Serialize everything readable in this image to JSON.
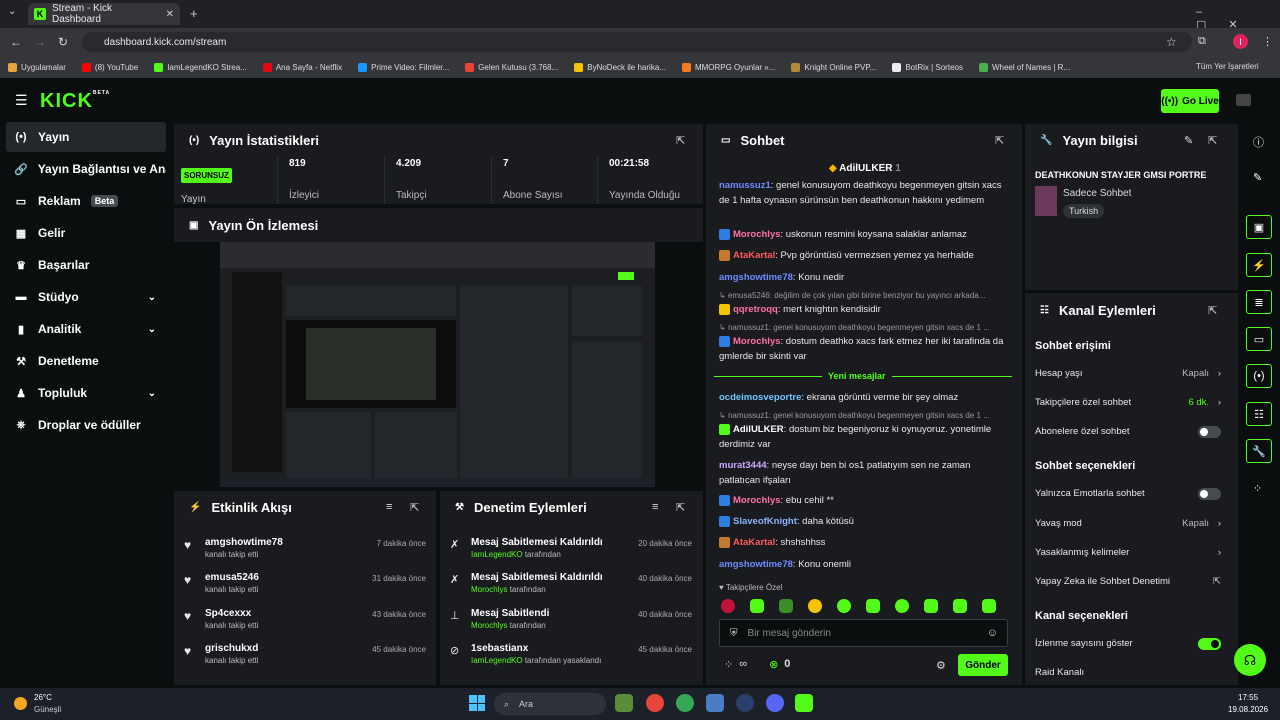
{
  "browser": {
    "tab_title": "Stream - Kick Dashboard",
    "url": "dashboard.kick.com/stream",
    "bookmarks": [
      "Uygulamalar",
      "(8) YouTube",
      "IamLegendKO Strea...",
      "Ana Sayfa - Netflix",
      "Prime Video: Filmler...",
      "Gelen Kutusu (3.768...",
      "ByNoDeck ile harika...",
      "MMORPG Oyunlar »...",
      "Knight Online PVP...",
      "BotRix | Sorteos",
      "Wheel of Names | R..."
    ],
    "all_bookmarks": "Tüm Yer İşaretleri",
    "profile_initial": "I"
  },
  "header": {
    "logo": "KICK",
    "logo_sup": "BETA",
    "go_live": "Go Live"
  },
  "sidebar": {
    "items": [
      {
        "label": "Yayın",
        "icon": "broadcast-icon"
      },
      {
        "label": "Yayın Bağlantısı ve Anahtarı",
        "icon": "link-icon"
      },
      {
        "label": "Reklam",
        "icon": "ad-icon",
        "badge": "Beta"
      },
      {
        "label": "Gelir",
        "icon": "revenue-icon"
      },
      {
        "label": "Başarılar",
        "icon": "trophy-icon"
      },
      {
        "label": "Stüdyo",
        "icon": "studio-icon"
      },
      {
        "label": "Analitik",
        "icon": "analytics-icon"
      },
      {
        "label": "Denetleme",
        "icon": "moderation-icon"
      },
      {
        "label": "Topluluk",
        "icon": "community-icon"
      },
      {
        "label": "Droplar ve ödüller",
        "icon": "gift-icon"
      }
    ]
  },
  "stats": {
    "title": "Yayın İstatistikleri",
    "status_badge": "SORUNSUZ",
    "status_label": "Yayın",
    "viewers": "819",
    "viewers_label": "İzleyici",
    "followers": "4.209",
    "followers_label": "Takipçi",
    "subs": "7",
    "subs_label": "Abone Sayısı",
    "uptime": "00:21:58",
    "uptime_label": "Yayında Olduğu"
  },
  "preview": {
    "title": "Yayın Ön İzlemesi"
  },
  "activity": {
    "title": "Etkinlik Akışı",
    "items": [
      {
        "user": "amgshowtime78",
        "action": "kanalı takip etti",
        "time": "7 dakika önce"
      },
      {
        "user": "emusa5246",
        "action": "kanalı takip etti",
        "time": "31 dakika önce"
      },
      {
        "user": "Sp4cexxx",
        "action": "kanalı takip etti",
        "time": "43 dakika önce"
      },
      {
        "user": "grischukxd",
        "action": "kanalı takip etti",
        "time": "45 dakika önce"
      }
    ]
  },
  "modlog": {
    "title": "Denetim Eylemleri",
    "items": [
      {
        "title": "Mesaj Sabitlemesi Kaldırıldı",
        "mod": "IamLegendKO",
        "suffix": "tarafından",
        "time": "20 dakika önce"
      },
      {
        "title": "Mesaj Sabitlemesi Kaldırıldı",
        "mod": "Morochlys",
        "suffix": "tarafından",
        "time": "40 dakika önce"
      },
      {
        "title": "Mesaj Sabitlendi",
        "mod": "Morochlys",
        "suffix": "tarafından",
        "time": "40 dakika önce"
      },
      {
        "title": "1sebastianx",
        "mod": "IamLegendKO",
        "suffix": "tarafından yasaklandı",
        "time": "45 dakika önce"
      }
    ]
  },
  "chat": {
    "title": "Sohbet",
    "pinned_user": "AdilULKER",
    "pinned_count": "1",
    "new_messages": "Yeni mesajlar",
    "messages": [
      {
        "user": "namussuz1",
        "color": "#6b8cff",
        "text": "genel konusuyom deathkoyu begenmeyen gitsin xacs de 1 hafta oynasın sürünsün ben deathkonun hakkını yedimem"
      },
      {
        "user": "Morochlys",
        "color": "#ff6fa8",
        "text": "uskonun resmini koysana salaklar anlamaz"
      },
      {
        "user": "AtaKartal",
        "color": "#ff5a5a",
        "text": "Pvp görüntüsü vermezsen yemez ya herhalde"
      },
      {
        "user": "amgshowtime78",
        "color": "#6b8cff",
        "text": "Konu nedir"
      },
      {
        "reply": "emusa5246: değilim de çok yılan gibi birine benziyor bu yayıncı arkada..."
      },
      {
        "user": "qqretroqq",
        "color": "#ff6fa8",
        "text": "mert knightın kendisidir"
      },
      {
        "reply": "namussuz1: genel konusuyom deathkoyu begenmeyen gitsin xacs de 1 ..."
      },
      {
        "user": "Morochlys",
        "color": "#ff6fa8",
        "text": "dostum deathko xacs fark etmez her iki tarafinda da gmlerde bir skinti var"
      },
      {
        "user": "ocdeimosveportre",
        "color": "#6ec8ff",
        "text": "ekrana görüntü verme bir şey olmaz"
      },
      {
        "reply": "namussuz1: genel konusuyom deathkoyu begenmeyen gitsin xacs de 1 ..."
      },
      {
        "user": "AdilULKER",
        "color": "#ffffff",
        "text": "dostum biz begeniyoruz ki oynuyoruz. yonetimle derdimiz var"
      },
      {
        "user": "murat3444",
        "color": "#c8a8ff",
        "text": "neyse dayı ben bi os1 patlatıyım sen ne zaman patlatıcan ifşaları"
      },
      {
        "user": "Morochlys",
        "color": "#ff6fa8",
        "text": "ebu cehil **"
      },
      {
        "user": "SlaveofKnight",
        "color": "#8ab4ff",
        "text": "daha kötüsü"
      },
      {
        "user": "AtaKartal",
        "color": "#ff5a5a",
        "text": "shshshhss"
      },
      {
        "user": "amgshowtime78",
        "color": "#6b8cff",
        "text": "Konu onemli"
      }
    ],
    "followers_only": "Takipçilere Özel",
    "input_placeholder": "Bir mesaj gönderin",
    "send": "Gönder",
    "infinity": "∞",
    "points": "0"
  },
  "stream_info": {
    "title": "Yayın bilgisi",
    "stream_title": "DEATHKONUN STAYJER GMSI PORTRE",
    "category": "Sadece Sohbet",
    "tag": "Turkish"
  },
  "channel_actions": {
    "title": "Kanal Eylemleri",
    "chat_access": "Sohbet erişimi",
    "account_age": "Hesap yaşı",
    "account_age_val": "Kapalı",
    "followers_chat": "Takipçilere özel sohbet",
    "followers_chat_val": "6 dk.",
    "subs_chat": "Abonelere özel sohbet",
    "chat_options": "Sohbet seçenekleri",
    "emote_only": "Yalnızca Emotlarla sohbet",
    "slow_mode": "Yavaş mod",
    "slow_mode_val": "Kapalı",
    "banned_words": "Yasaklanmış kelimeler",
    "ai_moderation": "Yapay Zeka ile Sohbet Denetimi",
    "channel_options": "Kanal seçenekleri",
    "show_viewers": "İzlenme sayısını göster",
    "raid": "Raid Kanalı"
  },
  "taskbar": {
    "temp": "26°C",
    "weather": "Güneşli",
    "search": "Ara",
    "time": "17:55",
    "date": "19.08.2026"
  }
}
